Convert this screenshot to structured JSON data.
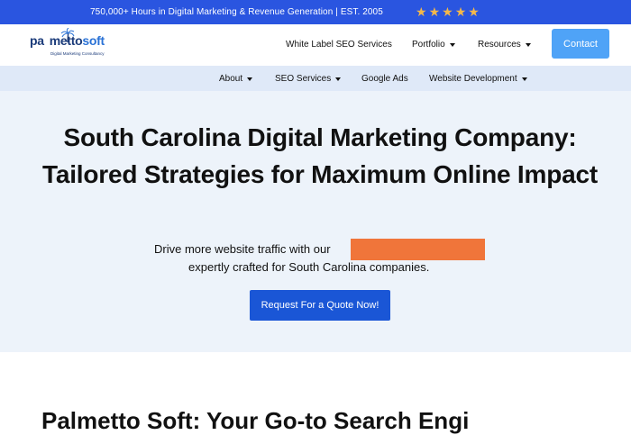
{
  "topbar": {
    "tagline": "750,000+ Hours in Digital Marketing & Revenue Generation | EST. 2005",
    "rating_stars": 5,
    "star_color": "#f4b84a",
    "background": "#2a55e0"
  },
  "logo": {
    "name_part1": "pa",
    "name_part2": "metto",
    "name_part3": "soft",
    "subtitle": "Digital Marketing Consultancy"
  },
  "main_nav": {
    "white_label": "White Label SEO Services",
    "portfolio": "Portfolio",
    "resources": "Resources",
    "contact": "Contact"
  },
  "sub_nav": {
    "about": "About",
    "seo_services": "SEO Services",
    "google_ads": "Google Ads",
    "website_development": "Website Development"
  },
  "hero": {
    "title": "South Carolina Digital Marketing Company: Tailored Strategies for Maximum Online Impact",
    "description_line1": "Drive more website traffic with our",
    "description_line2": "expertly crafted for South Carolina companies.",
    "cta": "Request For a Quote Now!",
    "redaction_color": "#f0753a"
  },
  "next_section": {
    "heading": "Palmetto Soft: Your Go-to Search Engi"
  },
  "colors": {
    "accent_blue": "#1a56d6",
    "contact_blue": "#4fa3f7",
    "subnav_bg": "#dfe9f8",
    "hero_bg": "#edf3fa"
  }
}
